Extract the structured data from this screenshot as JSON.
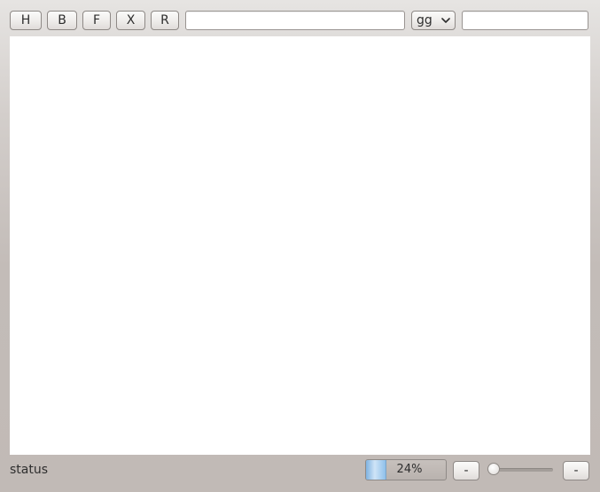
{
  "toolbar": {
    "buttons": [
      "H",
      "B",
      "F",
      "X",
      "R"
    ],
    "url_input": {
      "value": "",
      "placeholder": ""
    },
    "select": {
      "selected": "gg"
    },
    "search_input": {
      "value": "",
      "placeholder": ""
    }
  },
  "statusbar": {
    "status_text": "status",
    "progress": {
      "percent": 24,
      "label": "24%"
    },
    "minus_left_label": "-",
    "slider_value": 0,
    "minus_right_label": "-"
  },
  "icons": {
    "select_arrow": "chevron-down-icon"
  },
  "colors": {
    "canvas_background": "#ffffff",
    "progress_fill": "#8fc0ea"
  }
}
